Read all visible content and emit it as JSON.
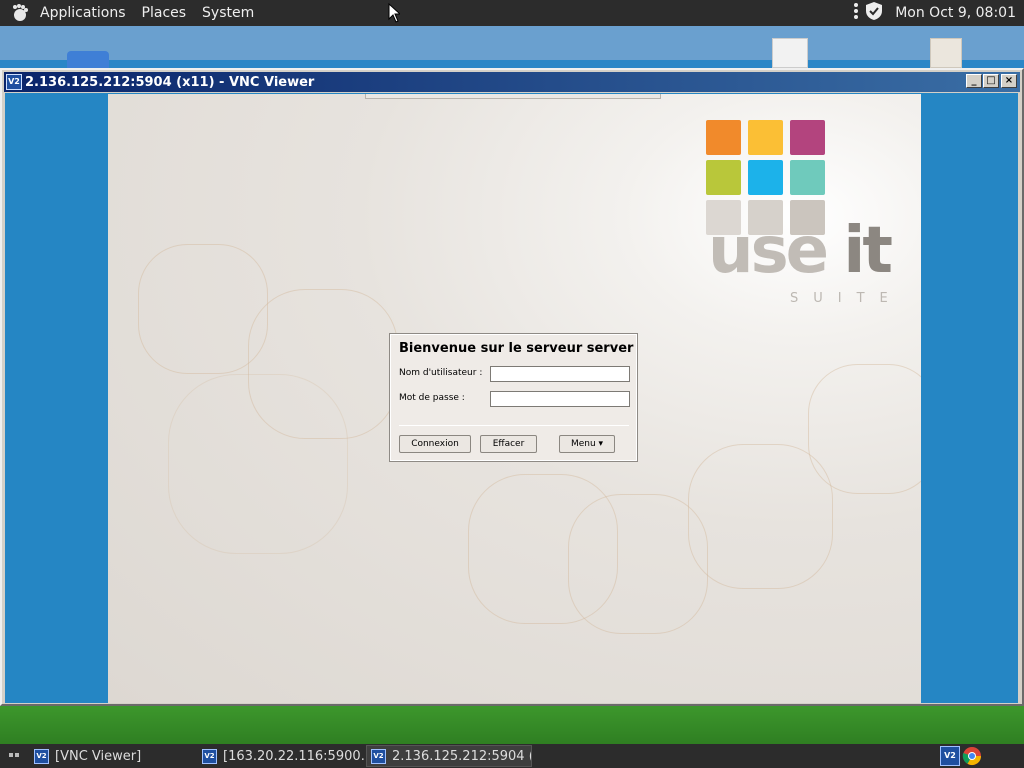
{
  "top_panel": {
    "menus": [
      "Applications",
      "Places",
      "System"
    ],
    "clock": "Mon Oct  9, 08:01",
    "icons": [
      "gnome-foot-icon",
      "more-vert-icon",
      "shield-icon"
    ]
  },
  "vnc_window": {
    "title": "2.136.125.212:5904 (x11) - VNC Viewer",
    "app_icon_text": "V2",
    "minimize": "_",
    "maximize": "□",
    "close": "×"
  },
  "remote": {
    "logo": {
      "word1": "use",
      "word2": "it",
      "tagline": "SUITE",
      "tile_colors": [
        "#f18a2b",
        "#fbbf35",
        "#b3447e",
        "#b9c73a",
        "#1cb2ea",
        "#6fcabc",
        "#dcd7d2",
        "#d6d1cb",
        "#cbc5be"
      ]
    },
    "login": {
      "title": "Bienvenue sur le serveur server",
      "username_label": "Nom d'utilisateur :",
      "password_label": "Mot de passe :",
      "username_value": "",
      "password_value": "",
      "buttons": {
        "connect": "Connexion",
        "clear": "Effacer",
        "menu": "Menu ▾"
      }
    }
  },
  "taskbar": {
    "tasks": [
      {
        "label": "[VNC Viewer]",
        "active": false
      },
      {
        "label": "[163.20.22.116:5900…",
        "active": false
      },
      {
        "label": "2.136.125.212:5904 (…",
        "active": true
      }
    ],
    "task_icon_text": "V2",
    "tray": [
      "vnc-tray-icon",
      "chrome-icon"
    ]
  }
}
